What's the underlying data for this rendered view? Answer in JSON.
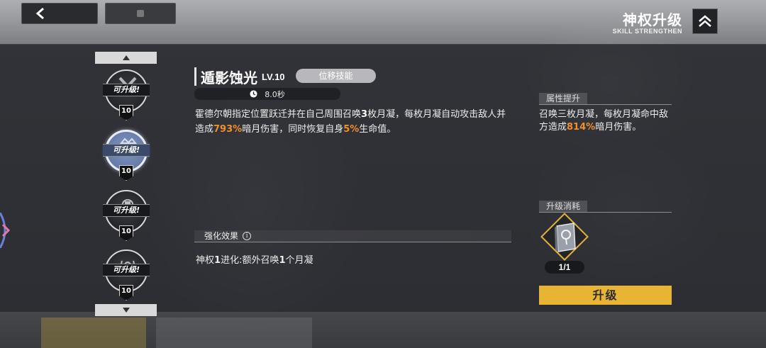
{
  "header": {
    "title": "神权升级",
    "subtitle": "SKILL STRENGTHEN"
  },
  "skill_list": {
    "items": [
      {
        "tag": "可升级!",
        "level": "10",
        "icon": "x-slash-icon",
        "active": false
      },
      {
        "tag": "可升级!",
        "level": "10",
        "icon": "crown-emblem-icon",
        "active": true
      },
      {
        "tag": "可升级!",
        "level": "10",
        "icon": "helmet-icon",
        "active": false
      },
      {
        "tag": "可升级!",
        "level": "10",
        "icon": "wreath-icon",
        "active": false
      }
    ]
  },
  "skill": {
    "name": "遁影蚀光",
    "level": "LV.10",
    "type": "位移技能",
    "cooldown": "8.0秒",
    "desc_parts": {
      "p1": "霍德尔朝指定位置跃迁并在自己周围召唤",
      "n1": "3",
      "p2": "枚月凝，每枚月凝自动攻击敌人并造成",
      "n2": "793%",
      "p3": "暗月伤害，同时恢复自身",
      "n3": "5%",
      "p4": "生命值。"
    }
  },
  "enhance": {
    "header": "强化效果",
    "info_icon": "info-icon",
    "text_parts": {
      "p1": "神权",
      "n1": "1",
      "p2": "进化:额外召唤",
      "n2": "1",
      "p3": "个月凝"
    }
  },
  "attribute": {
    "header": "属性提升",
    "p1": "召唤三枚月凝，每枚月凝命中敌方造成",
    "n1": "814%",
    "p2": "暗月伤害。"
  },
  "cost": {
    "header": "升级消耗",
    "item_icon": "skill-book-icon",
    "count": "1/1"
  },
  "upgrade_button": "升级",
  "colors": {
    "highlight": "#f0902a",
    "upgrade": "#e8b433",
    "item_frame": "#e2b33a"
  }
}
